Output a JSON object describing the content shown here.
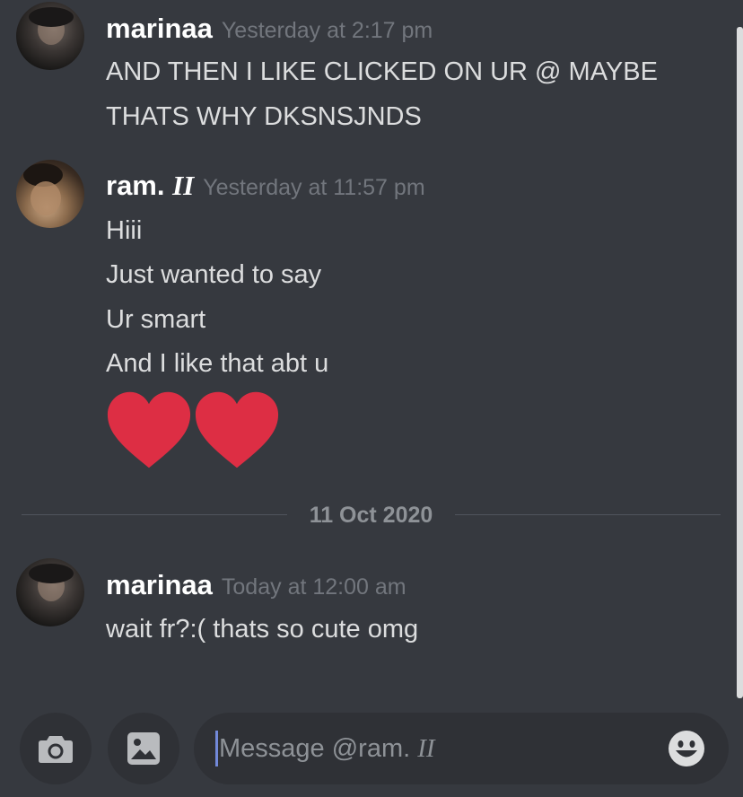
{
  "messages": [
    {
      "username": "marinaa",
      "username_tag": "",
      "timestamp": "Yesterday at 2:17 pm",
      "lines": [
        "AND THEN I LIKE CLICKED ON UR @ MAYBE",
        "THATS WHY DKSNSJNDS"
      ]
    },
    {
      "username": "ram. ",
      "username_tag": "II",
      "timestamp": "Yesterday at 11:57 pm",
      "lines": [
        "Hiii",
        "Just wanted to say",
        "Ur smart",
        "And I like that abt u"
      ],
      "emoji": [
        "red-heart",
        "red-heart"
      ]
    },
    {
      "username": "marinaa",
      "username_tag": "",
      "timestamp": "Today at 12:00 am",
      "lines": [
        "wait fr?:( thats so cute omg"
      ]
    }
  ],
  "divider": {
    "date": "11 Oct 2020"
  },
  "composer": {
    "placeholder_prefix": "Message @ram. ",
    "placeholder_tag": "II",
    "camera_icon": "camera-icon",
    "image_icon": "image-icon",
    "emoji_icon": "smiley-icon"
  },
  "colors": {
    "background": "#36393f",
    "input_background": "#2f3136",
    "username": "#ffffff",
    "message_text": "#dcddde",
    "timestamp": "#72767d",
    "heart": "#dd2e44",
    "caret": "#7289da"
  }
}
